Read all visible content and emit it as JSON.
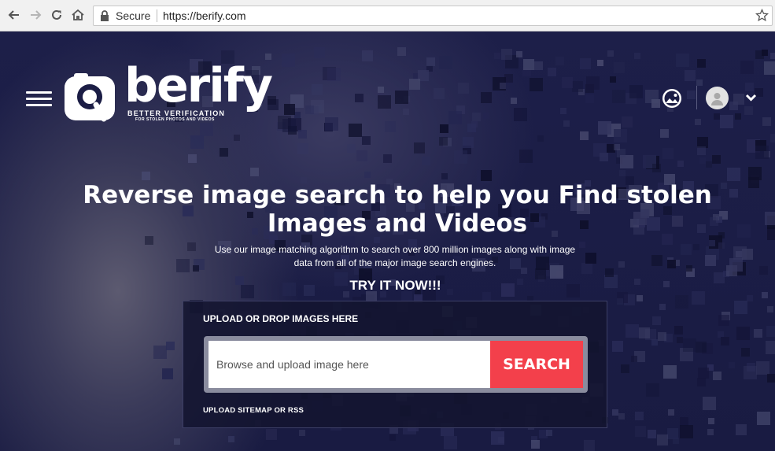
{
  "browser": {
    "secure_label": "Secure",
    "url": "https://berify.com",
    "icons": [
      "back-arrow-icon",
      "forward-arrow-icon",
      "reload-icon",
      "home-icon",
      "lock-icon",
      "bookmark-star-icon"
    ]
  },
  "header": {
    "logo_word": "berify",
    "logo_tagline": "BETTER VERIFICATION",
    "logo_subtagline": "FOR STOLEN PHOTOS AND VIDEOS",
    "icons": [
      "hamburger-menu-icon",
      "image-search-icon",
      "user-avatar-icon",
      "chevron-down-icon"
    ]
  },
  "hero": {
    "headline": "Reverse image search to help you Find stolen Images and Videos",
    "subtext": "Use our image matching algorithm to search over 800 million images along with image data from all of the major image search engines.",
    "cta": "TRY IT NOW!!!"
  },
  "search": {
    "panel_label": "UPLOAD OR DROP IMAGES HERE",
    "input_placeholder": "Browse and upload image here",
    "button_label": "SEARCH",
    "sitemap_link": "UPLOAD SITEMAP OR RSS"
  },
  "colors": {
    "background": "#1b1d45",
    "search_button": "#f3404b",
    "chrome": "#f1f1f1"
  }
}
